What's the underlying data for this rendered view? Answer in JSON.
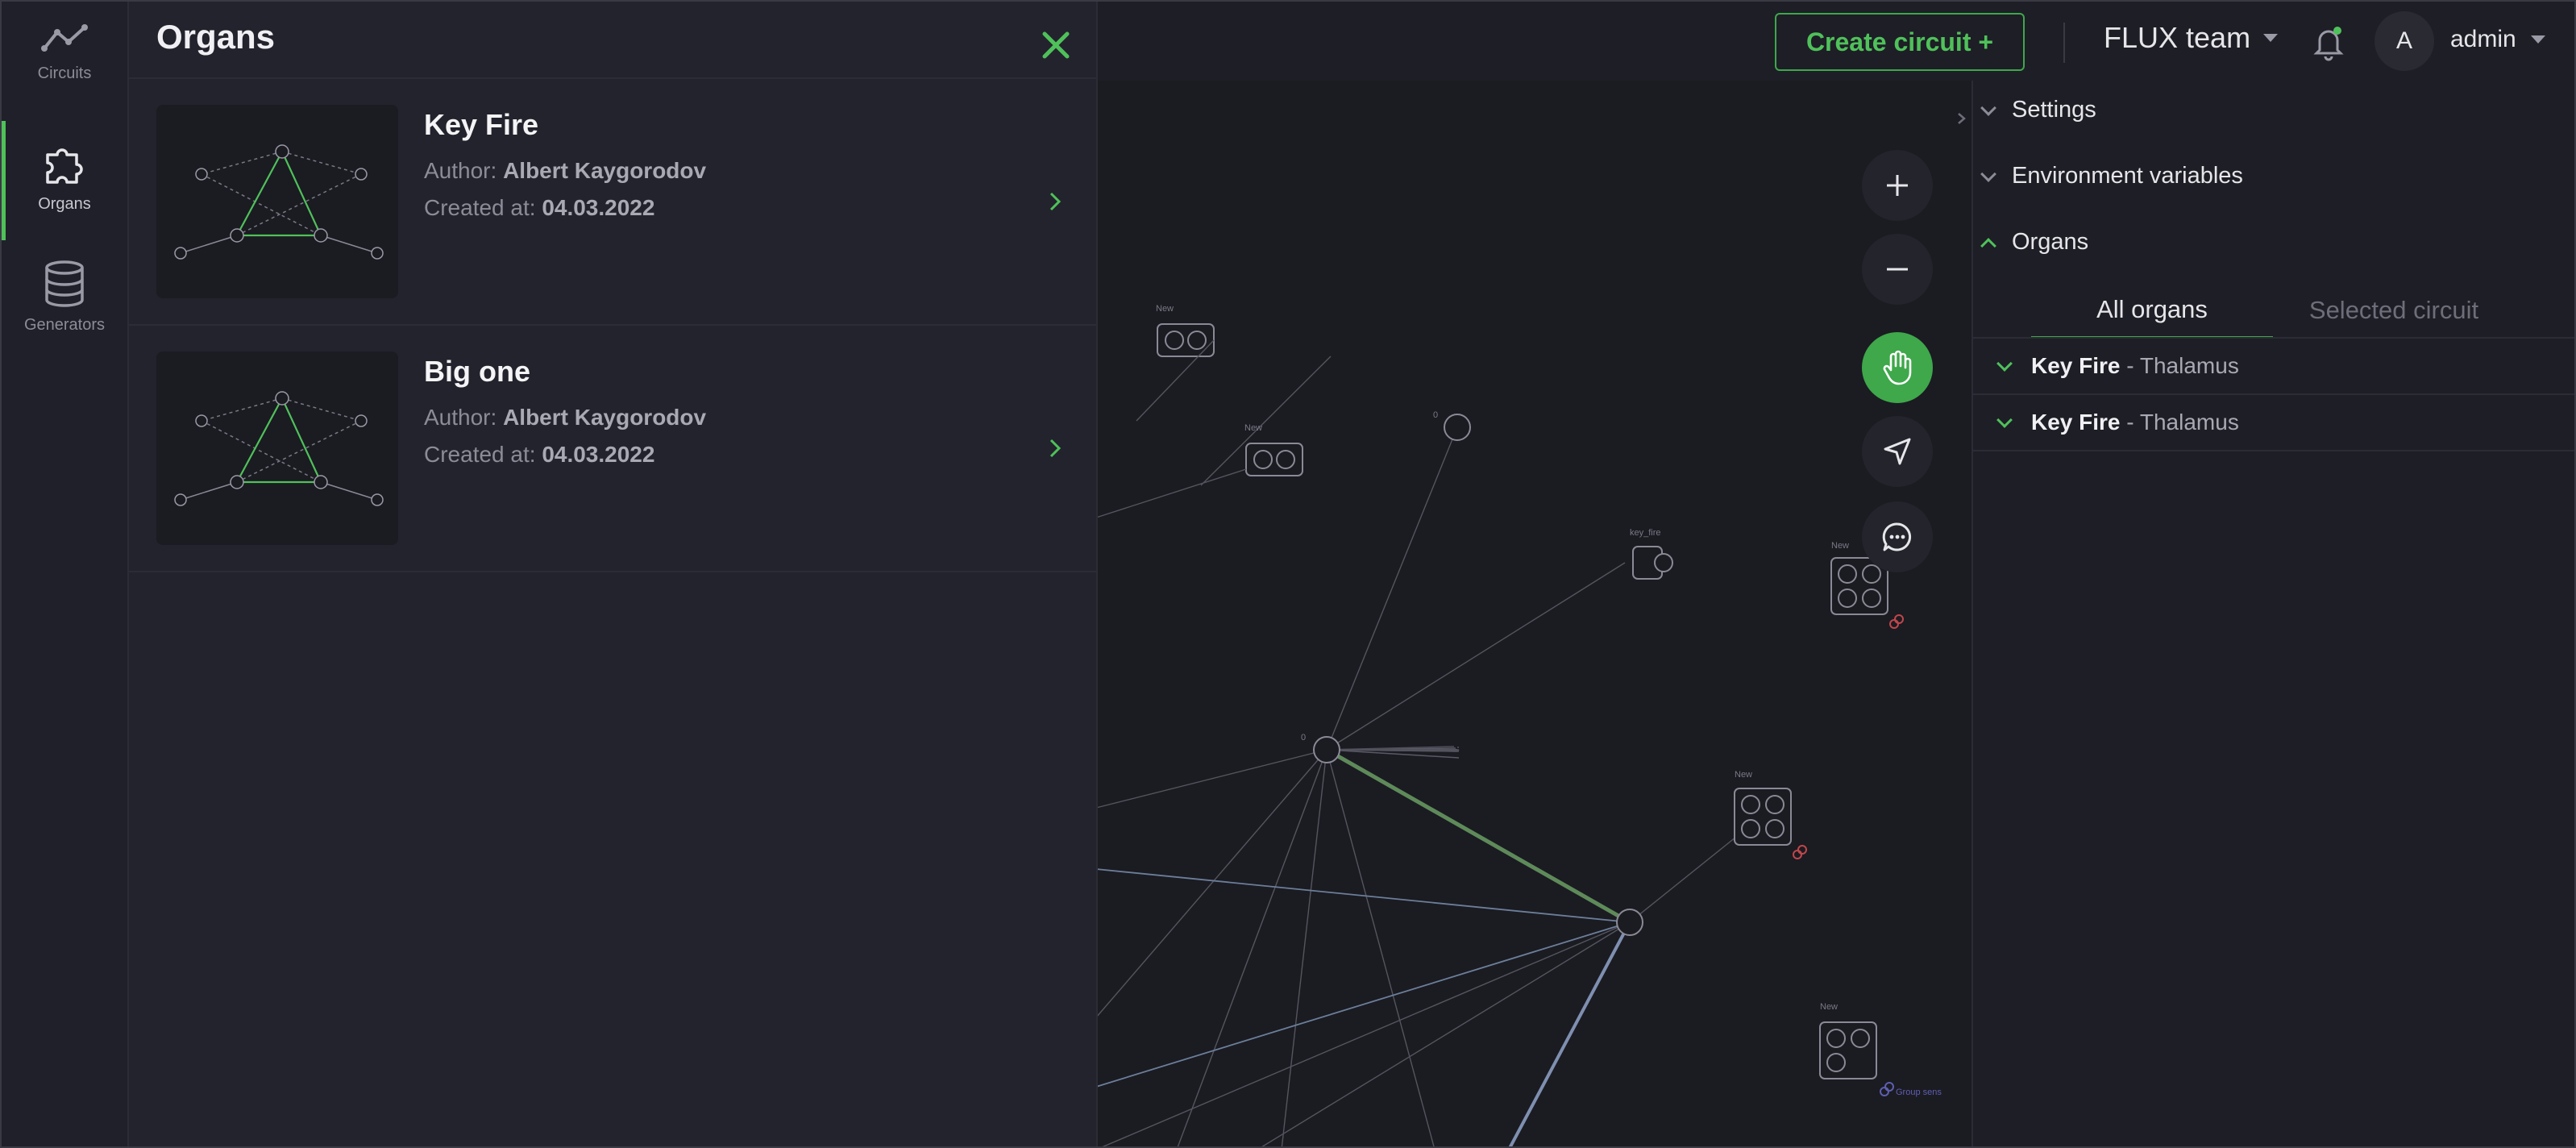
{
  "rail": {
    "items": [
      {
        "label": "Circuits",
        "icon": "chart-line-icon"
      },
      {
        "label": "Organs",
        "icon": "puzzle-icon"
      },
      {
        "label": "Generators",
        "icon": "database-icon"
      }
    ]
  },
  "topbar": {
    "create_label": "Create circuit +",
    "team": "FLUX team",
    "avatar_initial": "A",
    "user": "admin"
  },
  "panel": {
    "title": "Organs",
    "cards": [
      {
        "name": "Key Fire",
        "author_label": "Author:",
        "author": "Albert Kaygorodov",
        "created_label": "Created at:",
        "created": "04.03.2022"
      },
      {
        "name": "Big one",
        "author_label": "Author:",
        "author": "Albert Kaygorodov",
        "created_label": "Created at:",
        "created": "04.03.2022"
      }
    ]
  },
  "canvas": {
    "node_labels": [
      "New",
      "New",
      "0",
      "key_fire",
      "New",
      "0",
      "New",
      "New"
    ],
    "group_link_label": "Group sens"
  },
  "side": {
    "sections": [
      "Settings",
      "Environment variables",
      "Organs"
    ],
    "tabs": [
      "All organs",
      "Selected circuit"
    ],
    "rows": [
      {
        "name": "Key Fire",
        "suffix": " - Thalamus"
      },
      {
        "name": "Key Fire",
        "suffix": " - Thalamus"
      }
    ]
  },
  "colors": {
    "accent": "#4fc15a",
    "background": "#1b1b22",
    "panel": "#23232d"
  }
}
